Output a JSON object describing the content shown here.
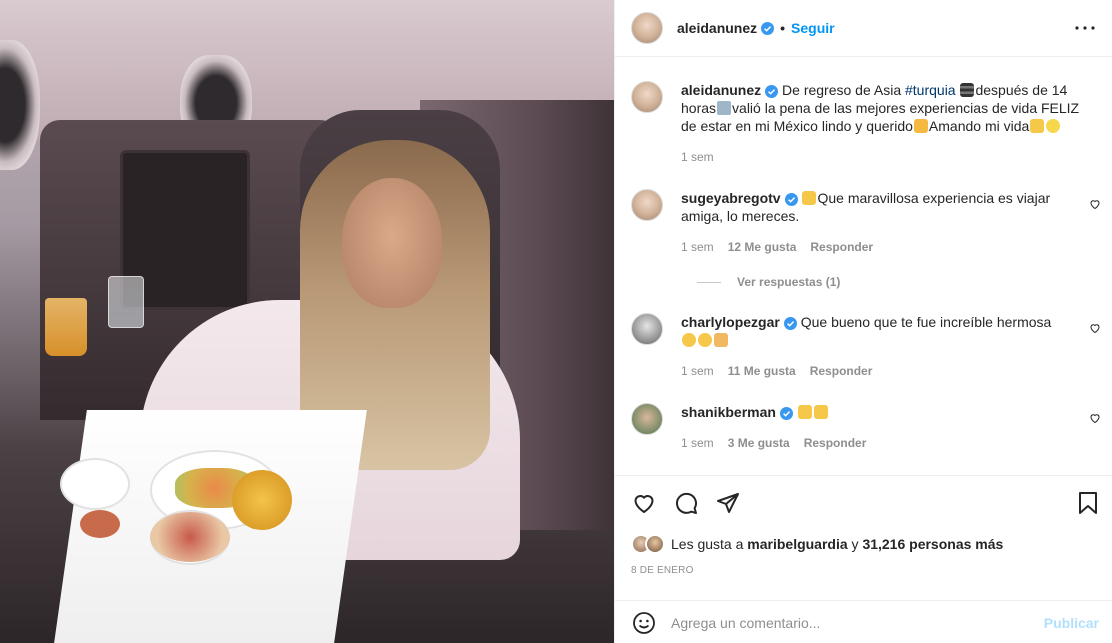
{
  "post": {
    "author": "aleidanunez",
    "follow_label": "Seguir",
    "caption_text_1": "De regreso de Asia ",
    "caption_hashtag": "#turquia",
    "caption_text_2": "después de 14 horas",
    "caption_text_3": "valió la pena de las mejores experiencias de vida FELIZ de estar en mi México lindo y querido",
    "caption_text_4": "Amando mi vida",
    "caption_time": "1 sem"
  },
  "comments": [
    {
      "user": "sugeyabregotv",
      "text": "Que maravillosa experiencia es viajar amiga, lo mereces.",
      "time": "1 sem",
      "likes": "12 Me gusta",
      "reply": "Responder",
      "view_replies": "Ver respuestas (1)"
    },
    {
      "user": "charlylopezgar",
      "text": "Que bueno que te fue increíble hermosa",
      "time": "1 sem",
      "likes": "11 Me gusta",
      "reply": "Responder"
    },
    {
      "user": "shanikberman",
      "text": "",
      "time": "1 sem",
      "likes": "3 Me gusta",
      "reply": "Responder"
    }
  ],
  "likes": {
    "prefix": "Les gusta a ",
    "user": "maribelguardia",
    "middle": " y ",
    "count": "31,216 personas más"
  },
  "date": "8 DE ENERO",
  "comment_input": {
    "placeholder": "Agrega un comentario...",
    "publish_label": "Publicar"
  },
  "colors": {
    "accent": "#0095f6",
    "verified": "#3897f0",
    "hashtag": "#00376b",
    "muted": "#8e8e8e",
    "publish_disabled": "#b2dffc"
  },
  "icons": [
    "more-icon",
    "heart-icon",
    "comment-icon",
    "share-icon",
    "bookmark-icon",
    "emoji-icon",
    "verified-icon"
  ]
}
